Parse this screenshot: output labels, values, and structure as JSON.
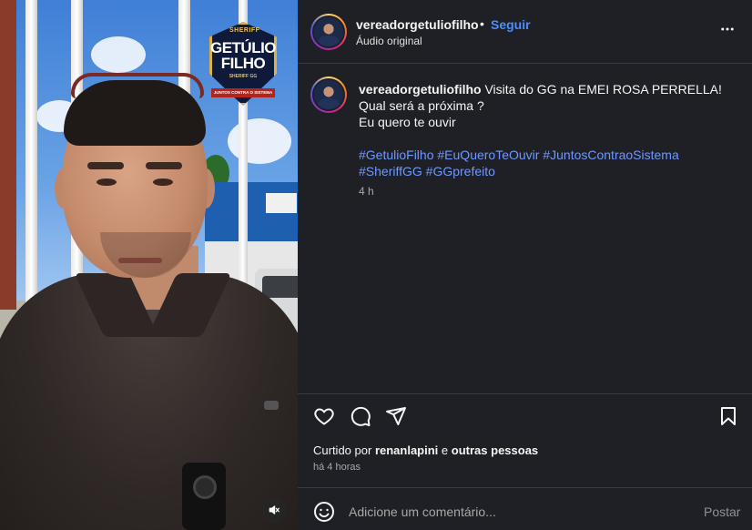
{
  "badge": {
    "top": "SHERIFF",
    "name_line1": "GETÚLIO",
    "name_line2": "FILHO",
    "sub": "SHERIFF GG",
    "ribbon": "JUNTOS CONTRA O SISTEMA"
  },
  "header": {
    "username": "vereadorgetuliofilho",
    "separator": "•",
    "follow_label": "Seguir",
    "audio": "Áudio original",
    "more_icon": "more-horizontal-icon"
  },
  "caption": {
    "username": "vereadorgetuliofilho",
    "line1": "Visita do GG na EMEI ROSA PERRELLA!",
    "line2": "Qual será a próxima ?",
    "line3": "Eu quero te ouvir",
    "hashtags": [
      "#GetulioFilho",
      "#EuQueroTeOuvir",
      "#JuntosContraoSistema",
      "#SheriffGG",
      "#GGprefeito"
    ],
    "time": "4 h"
  },
  "actions": {
    "like_icon": "heart-icon",
    "comment_icon": "comment-icon",
    "share_icon": "send-icon",
    "save_icon": "bookmark-icon"
  },
  "likes": {
    "prefix": "Curtido por",
    "user": "renanlapini",
    "connector": "e",
    "others": "outras pessoas"
  },
  "posted_ago": "há 4 horas",
  "comment": {
    "emoji_icon": "emoji-icon",
    "placeholder": "Adicione um comentário...",
    "post_label": "Postar"
  },
  "media": {
    "mute_icon": "muted-speaker-icon"
  },
  "colors": {
    "panel_bg": "#1f2025",
    "link_blue": "#4a8eff",
    "hashtag_blue": "#6f97ff",
    "muted_text": "#a8a8a8"
  }
}
